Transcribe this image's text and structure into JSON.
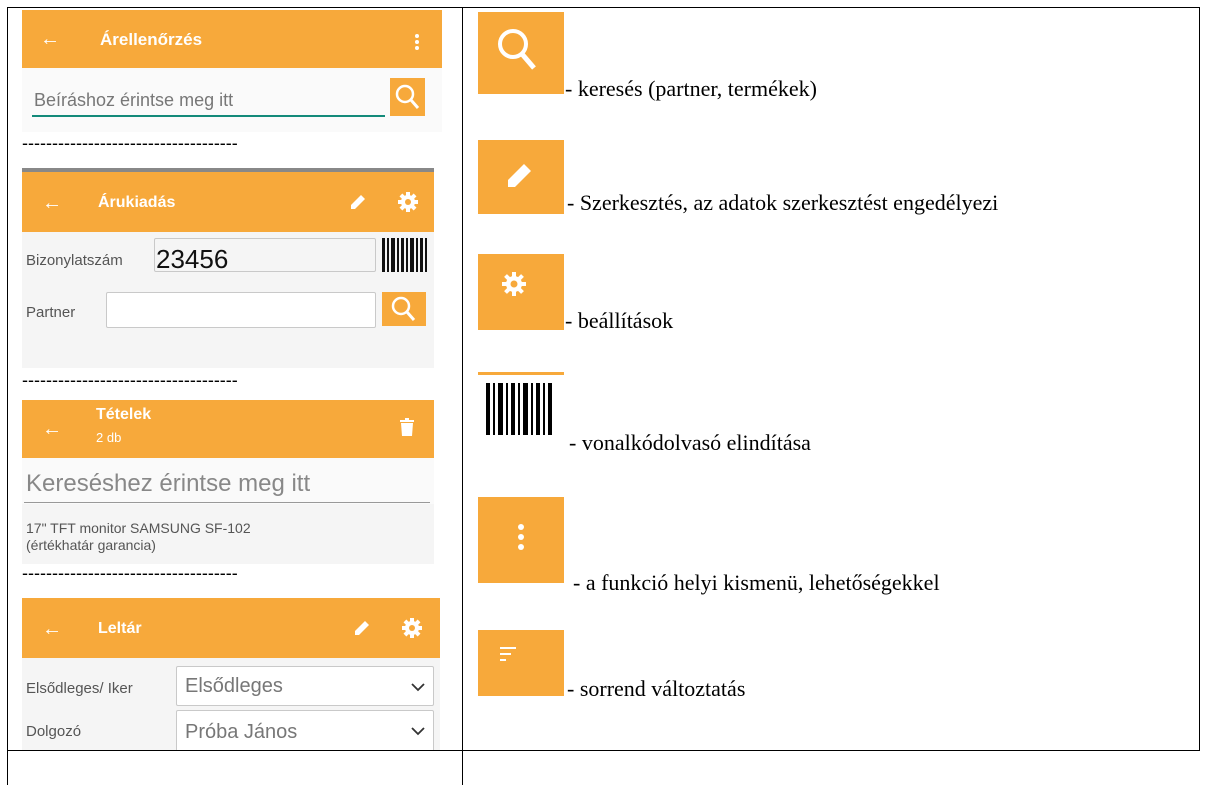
{
  "screens": {
    "price_check": {
      "title": "Árellenőrzés",
      "search_placeholder": "Beíráshoz érintse meg itt"
    },
    "goods_issue": {
      "title": "Árukiadás",
      "doc_label": "Bizonylatszám",
      "doc_value": "23456",
      "partner_label": "Partner"
    },
    "items": {
      "title": "Tételek",
      "count": "2 db",
      "search_placeholder": "Kereséshez érintse meg itt",
      "item_line1": "17\" TFT monitor SAMSUNG SF-102",
      "item_line2": "(értékhatár garancia)"
    },
    "inventory": {
      "title": "Leltár",
      "type_label": "Elsődleges/ Iker",
      "type_value": "Elsődleges",
      "worker_label": "Dolgozó",
      "worker_value": "Próba János"
    },
    "separator": "------------------------------------"
  },
  "legend": [
    {
      "icon": "search-icon",
      "text": "- keresés (partner, termékek)"
    },
    {
      "icon": "pencil-icon",
      "text": "- Szerkesztés, az adatok szerkesztést engedélyezi"
    },
    {
      "icon": "gear-icon",
      "text": "- beállítások"
    },
    {
      "icon": "barcode-icon",
      "text": "- vonalkódolvasó elindítása"
    },
    {
      "icon": "kebab-menu-icon",
      "text": "- a funkció helyi kismenü, lehetőségekkel"
    },
    {
      "icon": "sort-icon",
      "text": "- sorrend változtatás"
    }
  ],
  "colors": {
    "accent": "#f7a93b",
    "underline": "#138a7a"
  }
}
